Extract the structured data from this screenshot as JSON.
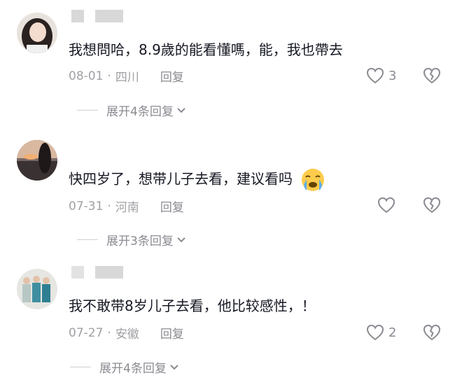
{
  "comments": [
    {
      "text": "我想問哈，8.9歲的能看懂嗎，能，我也帶去",
      "date": "08-01",
      "location": "四川",
      "reply_label": "回复",
      "likes": "3",
      "expand_label": "展开4条回复"
    },
    {
      "text": "快四岁了，想带儿子去看，建议看吗",
      "date": "07-31",
      "location": "河南",
      "reply_label": "回复",
      "likes": "",
      "expand_label": "展开3条回复"
    },
    {
      "text": "我不敢带8岁儿子去看，他比较感性，！",
      "date": "07-27",
      "location": "安徽",
      "reply_label": "回复",
      "likes": "2",
      "expand_label": "展开4条回复"
    }
  ],
  "separator": "·",
  "icons": {
    "like": "heart-outline-icon",
    "dislike": "broken-heart-icon",
    "expand": "chevron-down-icon",
    "emoji": "crying-face-emoji"
  },
  "colors": {
    "text": "#161823",
    "meta": "#a0a0a5",
    "icon": "#8a8b91"
  }
}
